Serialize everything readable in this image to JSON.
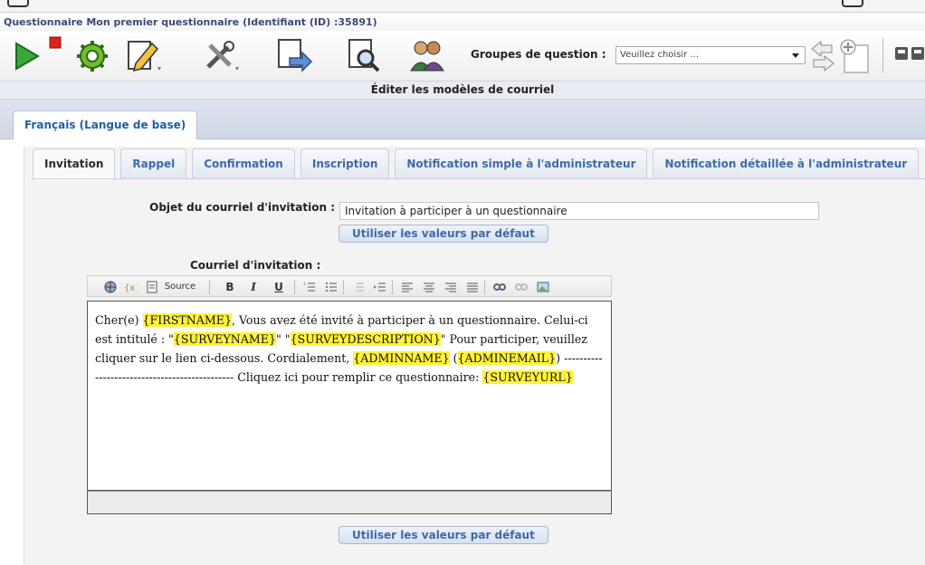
{
  "window": {
    "title": "Questionnaire Mon premier questionnaire (Identifiant (ID) :35891)"
  },
  "toolbar": {
    "icons": [
      "play-icon",
      "stop-icon",
      "settings-gear-icon",
      "edit-document-icon",
      "tools-icon",
      "survey-export-icon",
      "survey-search-icon",
      "participants-icon",
      "navigation-arrows-icon",
      "add-question-icon",
      "window-controls-icon"
    ],
    "groups_label": "Groupes de question :",
    "groups_select_value": "Veuillez choisir ..."
  },
  "section": {
    "title": "Éditer les modèles de courriel"
  },
  "language_tab": {
    "label": "Français (Langue de base)"
  },
  "tabs": [
    {
      "label": "Invitation",
      "active": true
    },
    {
      "label": "Rappel",
      "active": false
    },
    {
      "label": "Confirmation",
      "active": false
    },
    {
      "label": "Inscription",
      "active": false
    },
    {
      "label": "Notification simple à l'administrateur",
      "active": false
    },
    {
      "label": "Notification détaillée à l'administrateur",
      "active": false
    }
  ],
  "form": {
    "subject_label": "Objet du courriel d'invitation :",
    "subject_value": "Invitation à participer à un questionnaire",
    "default_button": "Utiliser les valeurs par défaut",
    "body_label": "Courriel d'invitation :",
    "default_button_bottom": "Utiliser les valeurs par défaut"
  },
  "editor_toolbar": {
    "source_label": "Source",
    "bold": "B",
    "italic": "I",
    "underline": "U"
  },
  "editor": {
    "segments": [
      {
        "text": "Cher(e) ",
        "hl": false
      },
      {
        "text": "{FIRSTNAME}",
        "hl": true
      },
      {
        "text": ", Vous avez été invité à participer à un questionnaire. Celui-ci est intitulé : \"",
        "hl": false
      },
      {
        "text": "{SURVEYNAME}",
        "hl": true
      },
      {
        "text": "\" \"",
        "hl": false
      },
      {
        "text": "{SURVEYDESCRIPTION}",
        "hl": true
      },
      {
        "text": "\" Pour participer, veuillez cliquer sur le lien ci-dessous. Cordialement, ",
        "hl": false
      },
      {
        "text": "{ADMINNAME}",
        "hl": true
      },
      {
        "text": " (",
        "hl": false
      },
      {
        "text": "{ADMINEMAIL}",
        "hl": true
      },
      {
        "text": ") ---------------------------------------------- Cliquez ici pour remplir ce questionnaire: ",
        "hl": false
      },
      {
        "text": "{SURVEYURL}",
        "hl": true
      }
    ]
  },
  "colors": {
    "link_blue": "#3d6aa6",
    "highlight_yellow": "#fff23a",
    "title_navy": "#3d4a78"
  }
}
